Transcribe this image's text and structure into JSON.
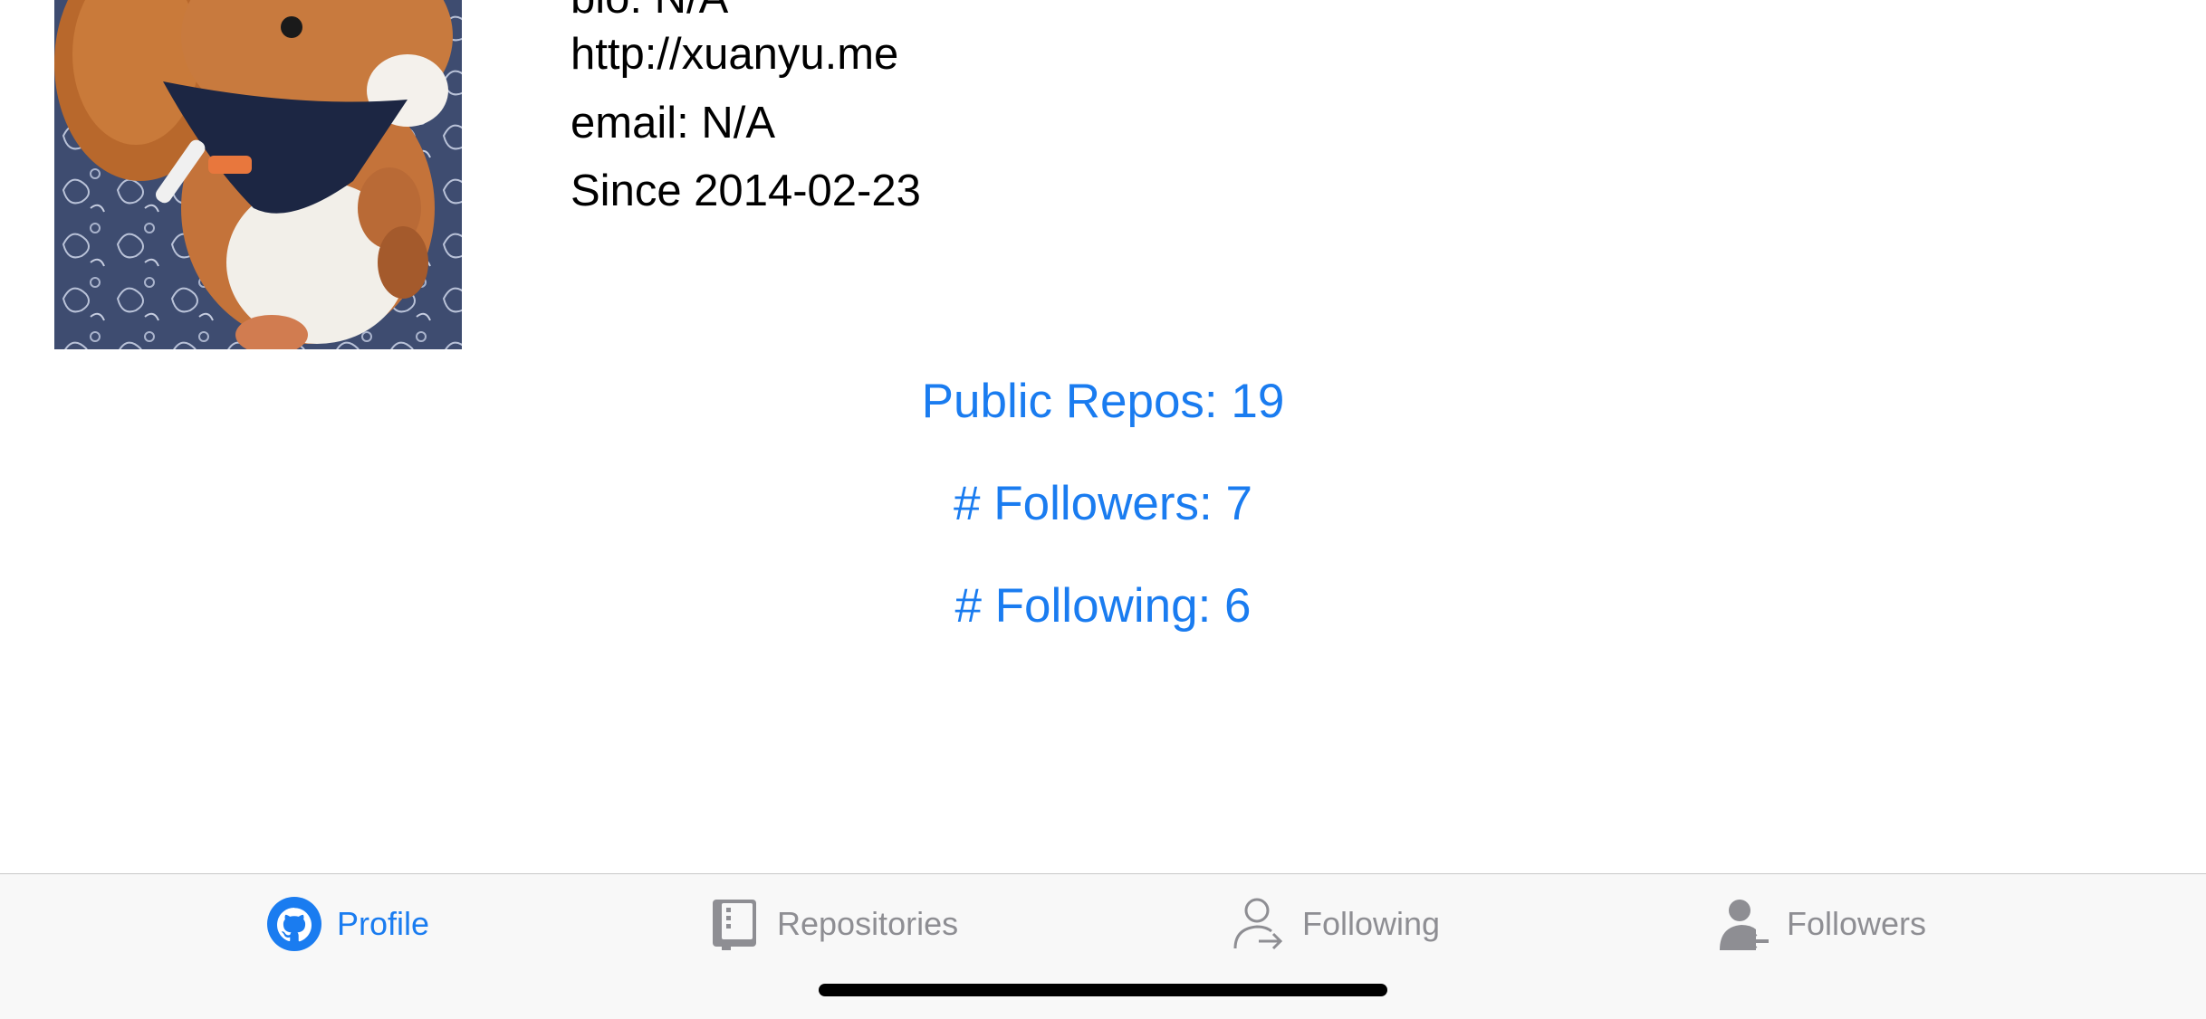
{
  "profile": {
    "bio": "bio: N/A",
    "blog": "http://xuanyu.me",
    "email": "email: N/A",
    "since": "Since 2014-02-23"
  },
  "stats": {
    "public_repos": "Public Repos: 19",
    "followers": "# Followers: 7",
    "following": "# Following: 6"
  },
  "tabbar": {
    "items": [
      {
        "label": "Profile",
        "icon": "github-octocat-icon",
        "active": true
      },
      {
        "label": "Repositories",
        "icon": "repo-book-icon",
        "active": false
      },
      {
        "label": "Following",
        "icon": "person-outgoing-icon",
        "active": false
      },
      {
        "label": "Followers",
        "icon": "person-incoming-icon",
        "active": false
      }
    ]
  },
  "colors": {
    "accent": "#1a7cf0",
    "inactive": "#8e8e93",
    "tabbar_bg": "#f8f8f8"
  }
}
